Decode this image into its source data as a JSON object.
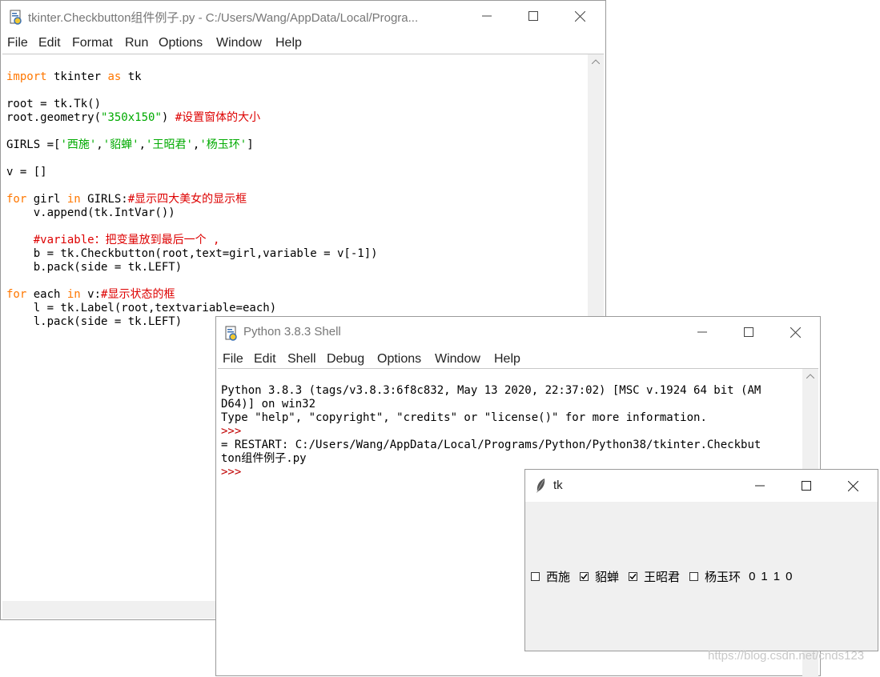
{
  "editor": {
    "title": "tkinter.Checkbutton组件例子.py - C:/Users/Wang/AppData/Local/Progra...",
    "menu": [
      "File",
      "Edit",
      "Format",
      "Run",
      "Options",
      "Window",
      "Help"
    ],
    "code": {
      "l1_kw1": "import",
      "l1_mid": " tkinter ",
      "l1_kw2": "as",
      "l1_end": " tk",
      "l3": "root = tk.Tk()",
      "l4_a": "root.geometry(",
      "l4_str": "\"350x150\"",
      "l4_b": ") ",
      "l4_cmt": "#设置窗体的大小",
      "l6_a": "GIRLS =[",
      "l6_s1": "'西施'",
      "l6_c1": ",",
      "l6_s2": "'貂蝉'",
      "l6_c2": ",",
      "l6_s3": "'王昭君'",
      "l6_c3": ",",
      "l6_s4": "'杨玉环'",
      "l6_b": "]",
      "l8": "v = []",
      "l10_kw1": "for",
      "l10_a": " girl ",
      "l10_kw2": "in",
      "l10_b": " GIRLS:",
      "l10_cmt": "#显示四大美女的显示框",
      "l11": "    v.append(tk.IntVar())",
      "l13_cmt": "    #variable：把变量放到最后一个 ,",
      "l14": "    b = tk.Checkbutton(root,text=girl,variable = v[-1])",
      "l15": "    b.pack(side = tk.LEFT)",
      "l17_kw1": "for",
      "l17_a": " each ",
      "l17_kw2": "in",
      "l17_b": " v:",
      "l17_cmt": "#显示状态的框",
      "l18": "    l = tk.Label(root,textvariable=each)",
      "l19": "    l.pack(side = tk.LEFT)"
    }
  },
  "shell": {
    "title": "Python 3.8.3 Shell",
    "menu": [
      "File",
      "Edit",
      "Shell",
      "Debug",
      "Options",
      "Window",
      "Help"
    ],
    "lines": {
      "l1": "Python 3.8.3 (tags/v3.8.3:6f8c832, May 13 2020, 22:37:02) [MSC v.1924 64 bit (AM",
      "l2": "D64)] on win32",
      "l3": "Type \"help\", \"copyright\", \"credits\" or \"license()\" for more information.",
      "p1": ">>> ",
      "l5": "= RESTART: C:/Users/Wang/AppData/Local/Programs/Python/Python38/tkinter.Checkbut",
      "l6": "ton组件例子.py",
      "p2": ">>> "
    }
  },
  "tk": {
    "title": "tk",
    "checkbuttons": [
      {
        "label": "西施",
        "checked": false
      },
      {
        "label": "貂蝉",
        "checked": true
      },
      {
        "label": "王昭君",
        "checked": true
      },
      {
        "label": "杨玉环",
        "checked": false
      }
    ],
    "values": [
      "0",
      "1",
      "1",
      "0"
    ]
  },
  "watermark": "https://blog.csdn.net/cnds123"
}
